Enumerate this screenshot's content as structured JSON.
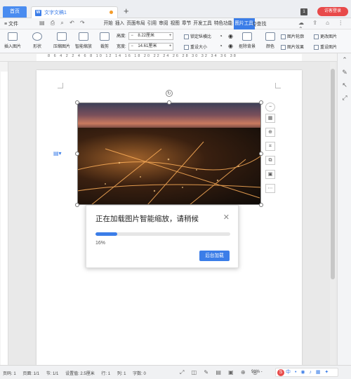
{
  "titlebar": {
    "home_tab": "首页",
    "doc_tab": "文字文稿1",
    "new_tab_symbol": "+",
    "badge": "1",
    "login_button": "访客登录"
  },
  "menubar": {
    "file": "≡ 文件",
    "tabs": [
      "开始",
      "插入",
      "页面布局",
      "引用",
      "审阅",
      "视图",
      "章节",
      "开发工具",
      "特色功能",
      "图片工具"
    ],
    "active_tab": "图片工具",
    "search": "Q查找"
  },
  "ribbon": {
    "insert_picture": "插入图片",
    "shape": "形状",
    "compress": "压缩图片",
    "smart_zoom": "智能缩放",
    "crop": "裁剪",
    "height_label": "高度:",
    "height_value": "8.22厘米",
    "width_label": "宽度:",
    "width_value": "14.61厘米",
    "lock_ratio": "锁定纵横比",
    "reset_size": "重设大小",
    "remove_bg": "抠除背景",
    "color": "颜色",
    "picture_outline": "图片轮廓",
    "change_picture": "更改图片",
    "picture_effects": "图片效果",
    "reset_picture": "重设图片"
  },
  "ruler": {
    "numbers": "8  6  4  2    2  4  6  8  10  12  14  16  18  20  22  24  26  28  30  32  34  36  38"
  },
  "dialog": {
    "title": "正在加载图片智能缩放，请稍候",
    "close": "✕",
    "progress": 0.16,
    "progress_label": "16%",
    "button": "后台加载"
  },
  "statusbar": {
    "page_num": "页码: 1",
    "pages": "页面: 1/1",
    "section": "节: 1/1",
    "position": "设置值: 2.5厘米",
    "row": "行: 1",
    "col": "列: 1",
    "words": "字数: 0",
    "zoom": "91% -"
  },
  "colors": {
    "accent": "#3b7de8",
    "login": "#e84a4a",
    "tab_modified_dot": "#f39c2a"
  }
}
